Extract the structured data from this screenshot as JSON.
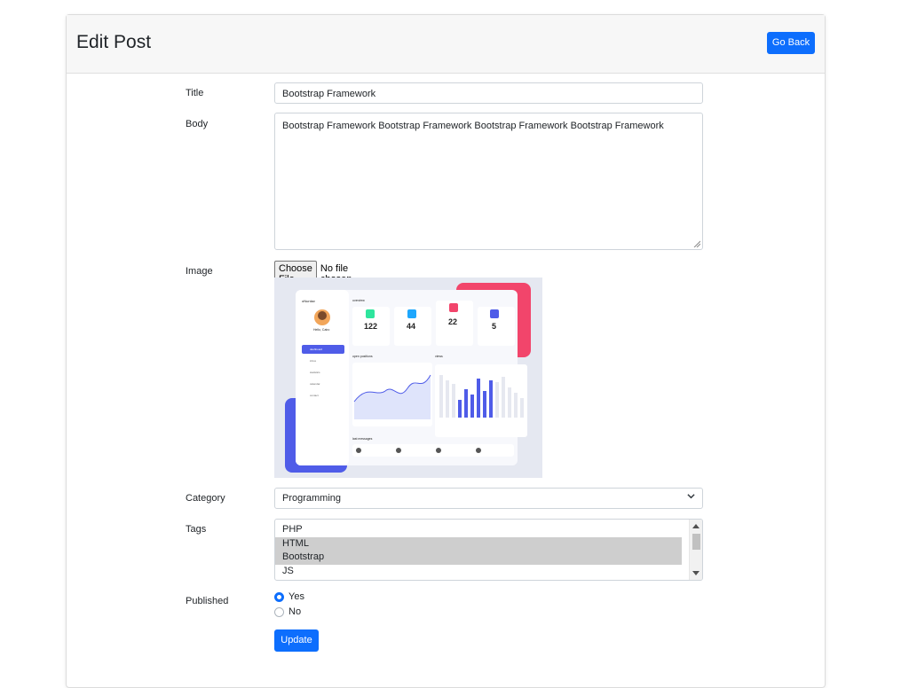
{
  "header": {
    "title": "Edit Post",
    "go_back_label": "Go Back"
  },
  "form": {
    "title_label": "Title",
    "title_value": "Bootstrap Framework",
    "body_label": "Body",
    "body_value": "Bootstrap Framework Bootstrap Framework Bootstrap Framework Bootstrap Framework",
    "image_label": "Image",
    "file_button_label": "Choose File",
    "file_status": "No file chosen",
    "category_label": "Category",
    "category_value": "Programming",
    "tags_label": "Tags",
    "tags_options": [
      {
        "label": "PHP",
        "selected": false
      },
      {
        "label": "HTML",
        "selected": true
      },
      {
        "label": "Bootstrap",
        "selected": true
      },
      {
        "label": "JS",
        "selected": false
      }
    ],
    "published_label": "Published",
    "published_options": [
      {
        "label": "Yes",
        "checked": true
      },
      {
        "label": "No",
        "checked": false
      }
    ],
    "update_label": "Update"
  },
  "preview": {
    "brand": "oNuntav",
    "greeting": "Hello, Cairo",
    "section_title": "overview",
    "stats": [
      "122",
      "44",
      "22",
      "5"
    ],
    "nav_items": [
      "dashboard",
      "inbox",
      "statistics",
      "calendar",
      "contact"
    ],
    "panel_left_title": "open positions",
    "panel_right_title": "views",
    "messages_title": "last messages"
  },
  "colors": {
    "primary": "#0d6efd",
    "preview_blue": "#4f5ce8",
    "preview_pink": "#f2456b"
  }
}
